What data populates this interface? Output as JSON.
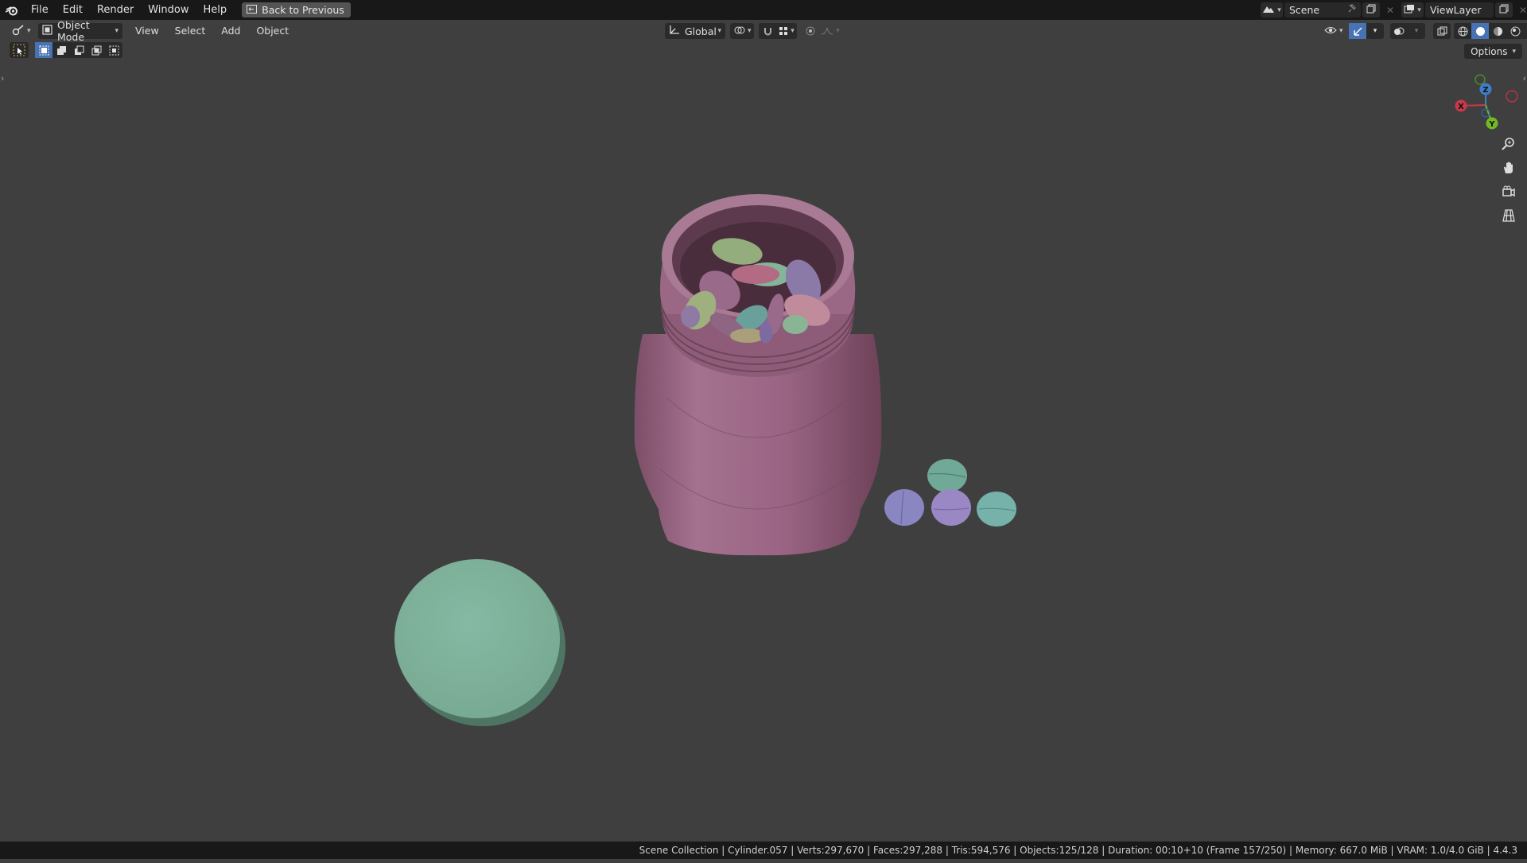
{
  "topbar": {
    "menus": [
      "File",
      "Edit",
      "Render",
      "Window",
      "Help"
    ],
    "back_button": "Back to Previous",
    "scene_label": "Scene",
    "viewlayer_label": "ViewLayer"
  },
  "viewport_header": {
    "mode": "Object Mode",
    "menus": [
      "View",
      "Select",
      "Add",
      "Object"
    ],
    "transform_orientation": "Global",
    "options_label": "Options"
  },
  "gizmo": {
    "x_label": "X",
    "y_label": "Y",
    "z_label": "Z"
  },
  "statusbar": {
    "collection": "Scene Collection",
    "object": "Cylinder.057",
    "verts": "Verts:297,670",
    "faces": "Faces:297,288",
    "tris": "Tris:594,576",
    "objects": "Objects:125/128",
    "duration": "Duration: 00:10+10 (Frame 157/250)",
    "memory": "Memory: 667.0 MiB",
    "vram": "VRAM: 1.0/4.0 GiB",
    "version": "4.4.3"
  },
  "colors": {
    "bg_viewport": "#3f3f3f",
    "bg_bar": "#181818",
    "accent_blue": "#4772b3",
    "bottle_pink": "#a9708f",
    "cap_green": "#82b09b"
  }
}
